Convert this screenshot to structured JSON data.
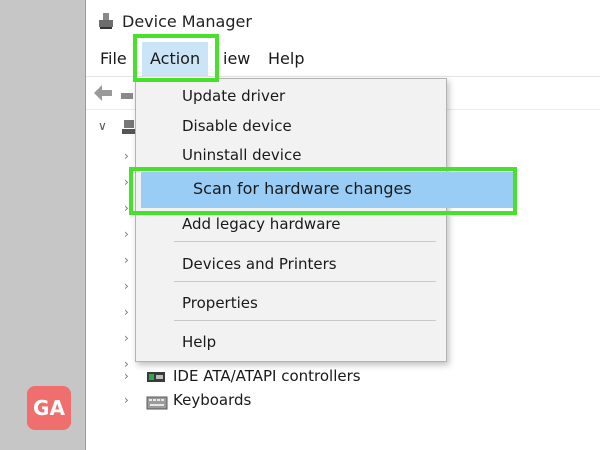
{
  "window": {
    "title": "Device Manager"
  },
  "menubar": {
    "items": [
      {
        "label": "File"
      },
      {
        "label": "Action"
      },
      {
        "label": "iew"
      },
      {
        "label": "Help"
      }
    ]
  },
  "action_menu": {
    "items": [
      {
        "label": "Update driver"
      },
      {
        "label": "Disable device"
      },
      {
        "label": "Uninstall device"
      },
      {
        "label": "Scan for hardware changes",
        "highlighted": true
      },
      {
        "label": "Add legacy hardware"
      },
      {
        "label": "Devices and Printers"
      },
      {
        "label": "Properties"
      },
      {
        "label": "Help"
      }
    ]
  },
  "tree": {
    "items": [
      {
        "label": "IDE ATA/ATAPI controllers",
        "icon": "ide-controller-icon"
      },
      {
        "label": "Keyboards",
        "icon": "keyboard-icon"
      }
    ]
  },
  "watermark": {
    "logo_text": "GA"
  },
  "colors": {
    "highlight_green": "#47e12c",
    "menu_selected_blue": "#99cdf6",
    "logo_red": "#ef6f6f"
  }
}
